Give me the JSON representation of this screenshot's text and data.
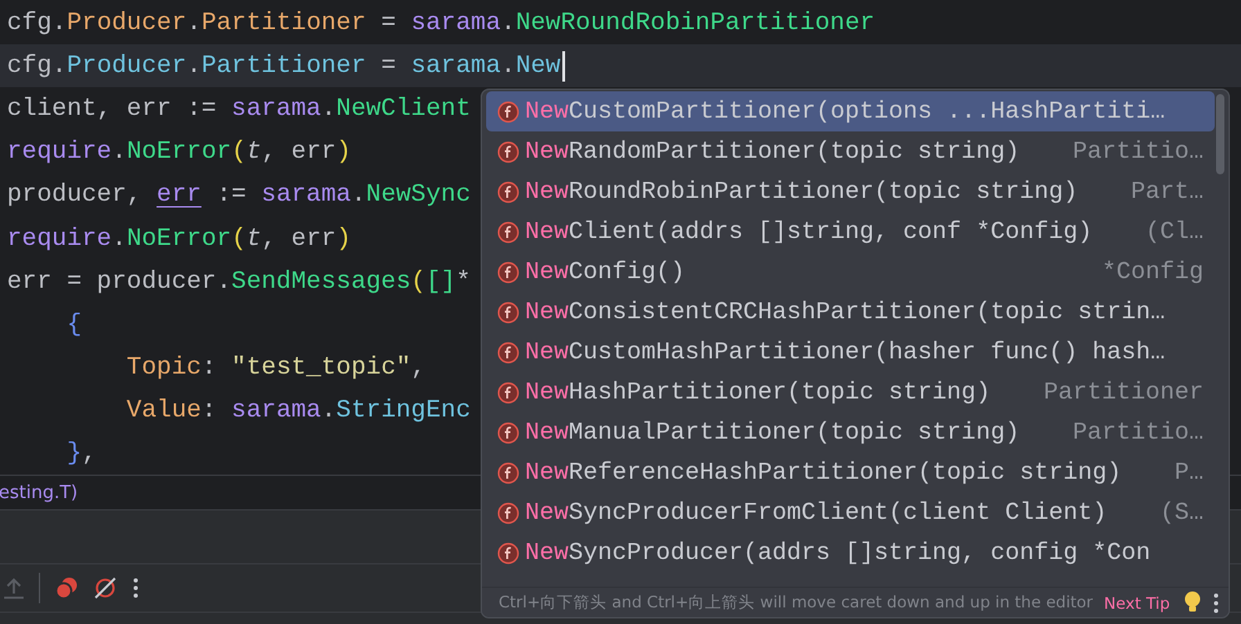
{
  "editor": {
    "lines": [
      {
        "current": false,
        "tokens": [
          {
            "t": "cfg.",
            "kind": "plain"
          },
          {
            "t": "Producer",
            "kind": "field"
          },
          {
            "t": ".",
            "kind": "plain"
          },
          {
            "t": "Partitioner",
            "kind": "field"
          },
          {
            "t": " = ",
            "kind": "plain"
          },
          {
            "t": "sarama",
            "kind": "pkg"
          },
          {
            "t": ".",
            "kind": "plain"
          },
          {
            "t": "NewRoundRobinPartitioner",
            "kind": "func"
          }
        ]
      },
      {
        "current": true,
        "tokens": [
          {
            "t": "cfg.",
            "kind": "plain"
          },
          {
            "t": "Producer",
            "kind": "member"
          },
          {
            "t": ".",
            "kind": "plain"
          },
          {
            "t": "Partitioner",
            "kind": "member"
          },
          {
            "t": " = ",
            "kind": "plain"
          },
          {
            "t": "sarama",
            "kind": "member"
          },
          {
            "t": ".",
            "kind": "plain"
          },
          {
            "t": "New",
            "kind": "member"
          }
        ]
      },
      {
        "current": false,
        "tokens": [
          {
            "t": "client, err := ",
            "kind": "plain"
          },
          {
            "t": "sarama",
            "kind": "pkg"
          },
          {
            "t": ".",
            "kind": "plain"
          },
          {
            "t": "NewClient",
            "kind": "func"
          }
        ]
      },
      {
        "current": false,
        "tokens": [
          {
            "t": "require",
            "kind": "pkg"
          },
          {
            "t": ".",
            "kind": "plain"
          },
          {
            "t": "NoError",
            "kind": "func"
          },
          {
            "t": "(",
            "kind": "paren"
          },
          {
            "t": "t",
            "kind": "param"
          },
          {
            "t": ", err",
            "kind": "plain"
          },
          {
            "t": ")",
            "kind": "paren"
          }
        ]
      },
      {
        "current": false,
        "tokens": [
          {
            "t": "producer, ",
            "kind": "plain"
          },
          {
            "t": "err",
            "kind": "warn"
          },
          {
            "t": " := ",
            "kind": "plain"
          },
          {
            "t": "sarama",
            "kind": "pkg"
          },
          {
            "t": ".",
            "kind": "plain"
          },
          {
            "t": "NewSync",
            "kind": "func"
          }
        ]
      },
      {
        "current": false,
        "tokens": [
          {
            "t": "require",
            "kind": "pkg"
          },
          {
            "t": ".",
            "kind": "plain"
          },
          {
            "t": "NoError",
            "kind": "func"
          },
          {
            "t": "(",
            "kind": "paren"
          },
          {
            "t": "t",
            "kind": "param"
          },
          {
            "t": ", err",
            "kind": "plain"
          },
          {
            "t": ")",
            "kind": "paren"
          }
        ]
      },
      {
        "current": false,
        "tokens": [
          {
            "t": "err = producer.",
            "kind": "plain"
          },
          {
            "t": "SendMessages",
            "kind": "func"
          },
          {
            "t": "(",
            "kind": "paren"
          },
          {
            "t": "[]",
            "kind": "bracket"
          },
          {
            "t": "*",
            "kind": "plain"
          }
        ]
      },
      {
        "current": false,
        "tokens": [
          {
            "t": "    {",
            "kind": "brace"
          }
        ]
      },
      {
        "current": false,
        "tokens": [
          {
            "t": "        Topic",
            "kind": "field"
          },
          {
            "t": ": ",
            "kind": "plain"
          },
          {
            "t": "\"test_topic\"",
            "kind": "string"
          },
          {
            "t": ",",
            "kind": "plain"
          }
        ]
      },
      {
        "current": false,
        "tokens": [
          {
            "t": "        Value",
            "kind": "field"
          },
          {
            "t": ": ",
            "kind": "plain"
          },
          {
            "t": "sarama",
            "kind": "pkg"
          },
          {
            "t": ".",
            "kind": "plain"
          },
          {
            "t": "StringEnc",
            "kind": "member"
          }
        ]
      },
      {
        "current": false,
        "tokens": [
          {
            "t": "    }",
            "kind": "brace"
          },
          {
            "t": ",",
            "kind": "plain"
          }
        ]
      }
    ]
  },
  "breadcrumb": "esting.T)",
  "completion": {
    "items": [
      {
        "match": "New",
        "rest": "CustomPartitioner(options ...HashPartiti…",
        "selected": true
      },
      {
        "match": "New",
        "rest": "RandomPartitioner(topic string)",
        "type": "Partitio…",
        "selected": false
      },
      {
        "match": "New",
        "rest": "RoundRobinPartitioner(topic string)",
        "type": "Part…",
        "selected": false
      },
      {
        "match": "New",
        "rest": "Client(addrs []string, conf *Config)",
        "type": "(Cl…",
        "selected": false
      },
      {
        "match": "New",
        "rest": "Config()",
        "type": "*Config",
        "selected": false
      },
      {
        "match": "New",
        "rest": "ConsistentCRCHashPartitioner(topic strin…",
        "selected": false
      },
      {
        "match": "New",
        "rest": "CustomHashPartitioner(hasher func() hash…",
        "selected": false
      },
      {
        "match": "New",
        "rest": "HashPartitioner(topic string)",
        "type": "Partitioner",
        "selected": false
      },
      {
        "match": "New",
        "rest": "ManualPartitioner(topic string)",
        "type": "Partitio…",
        "selected": false
      },
      {
        "match": "New",
        "rest": "ReferenceHashPartitioner(topic string)",
        "type": "P…",
        "selected": false
      },
      {
        "match": "New",
        "rest": "SyncProducerFromClient(client Client)",
        "type": "(S…",
        "selected": false
      },
      {
        "match": "New",
        "rest": "SyncProducer(addrs []string, config *Con",
        "selected": false
      }
    ],
    "hint": "Ctrl+向下箭头 and Ctrl+向上箭头 will move caret down and up in the editor",
    "next_tip": "Next Tip"
  }
}
